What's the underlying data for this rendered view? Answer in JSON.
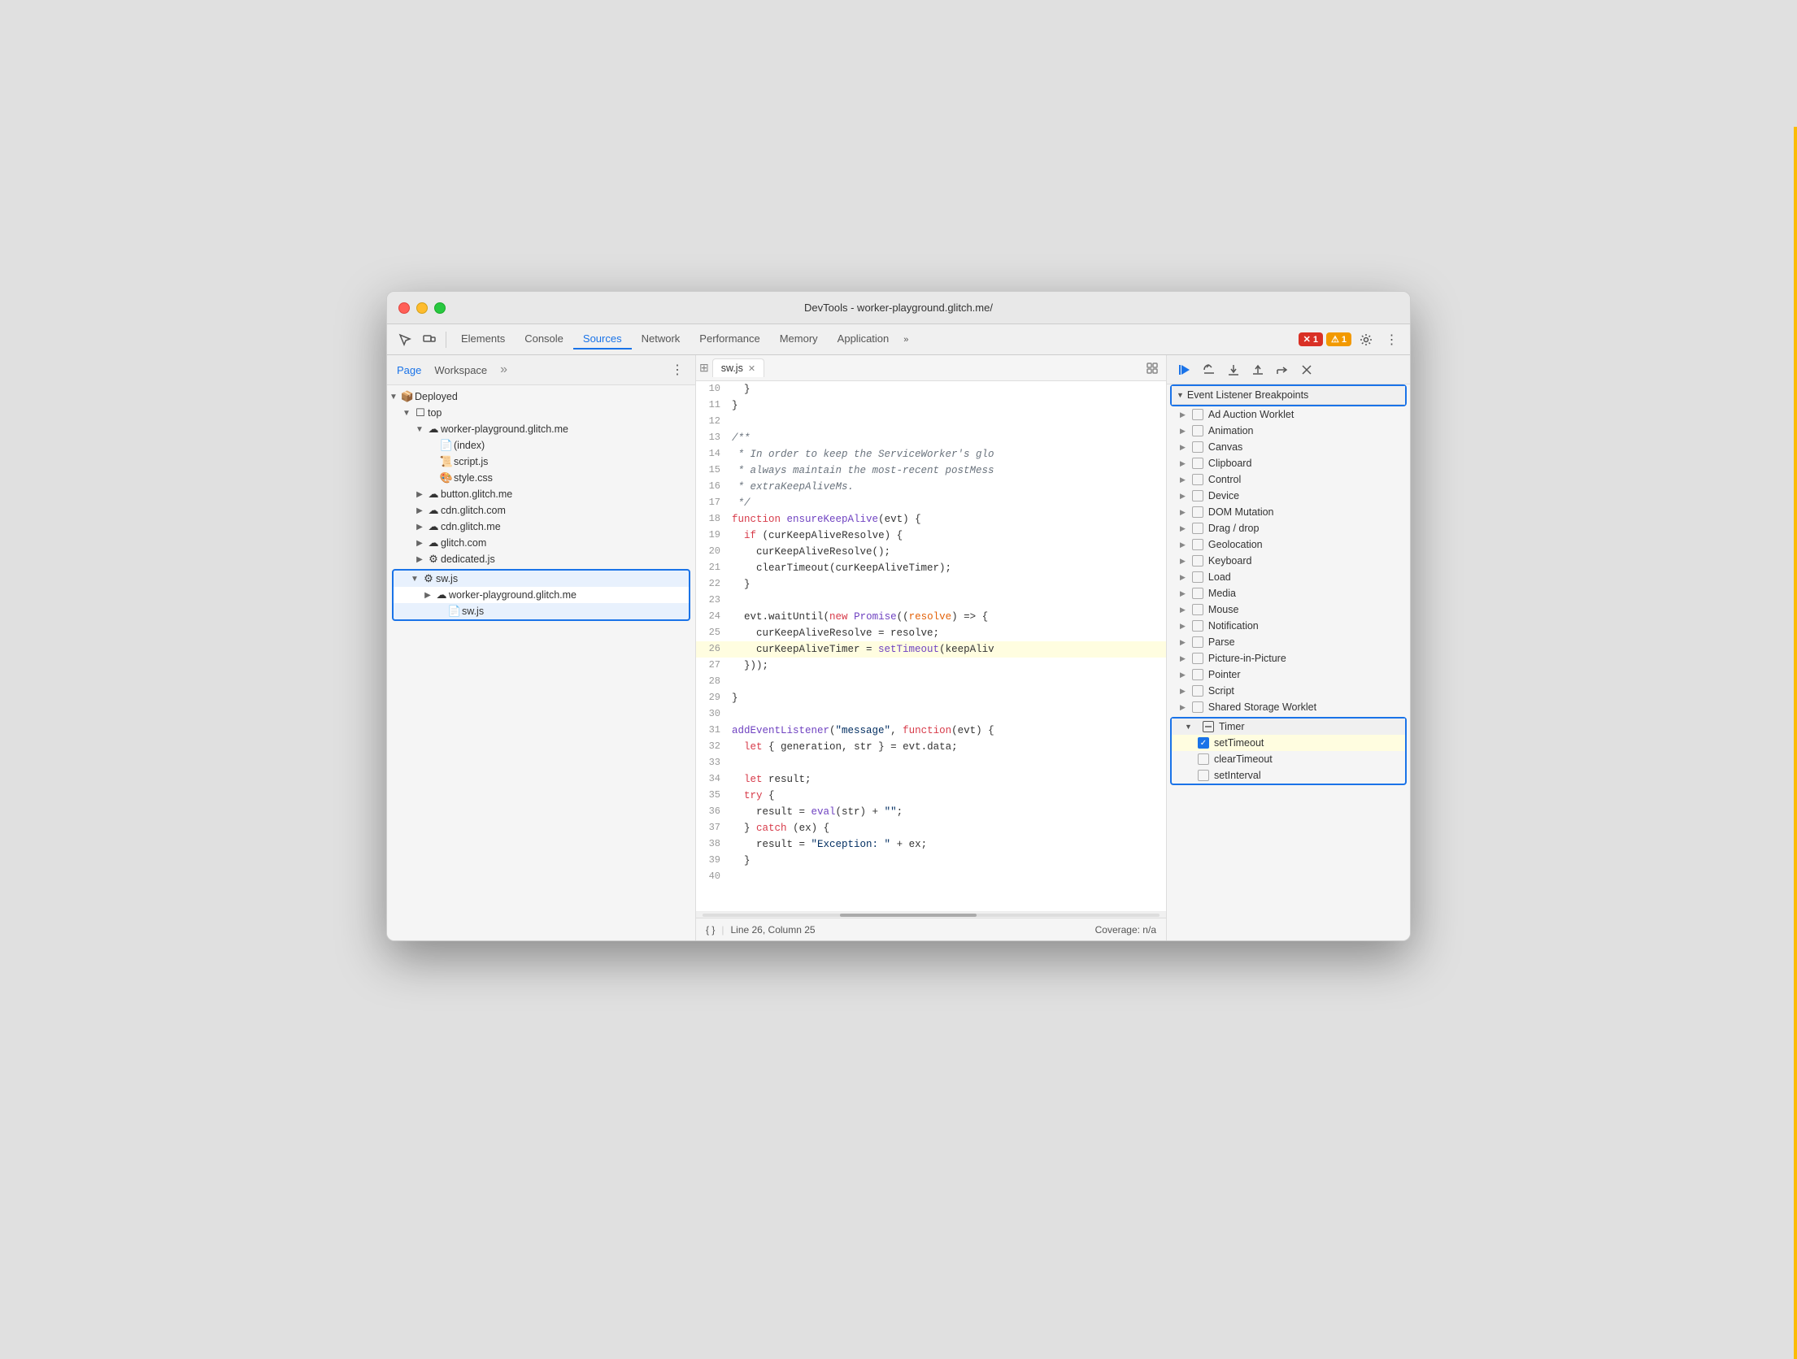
{
  "window": {
    "title": "DevTools - worker-playground.glitch.me/"
  },
  "toolbar": {
    "tabs": [
      {
        "id": "elements",
        "label": "Elements",
        "active": false
      },
      {
        "id": "console",
        "label": "Console",
        "active": false
      },
      {
        "id": "sources",
        "label": "Sources",
        "active": true
      },
      {
        "id": "network",
        "label": "Network",
        "active": false
      },
      {
        "id": "performance",
        "label": "Performance",
        "active": false
      },
      {
        "id": "memory",
        "label": "Memory",
        "active": false
      },
      {
        "id": "application",
        "label": "Application",
        "active": false
      }
    ],
    "more_tabs_label": "»",
    "error_count": "1",
    "warn_count": "1"
  },
  "file_panel": {
    "tabs": [
      {
        "id": "page",
        "label": "Page",
        "active": true
      },
      {
        "id": "workspace",
        "label": "Workspace",
        "active": false
      }
    ],
    "more": "»",
    "tree": [
      {
        "level": 0,
        "arrow": "▼",
        "icon": "📦",
        "label": "Deployed"
      },
      {
        "level": 1,
        "arrow": "▼",
        "icon": "☐",
        "label": "top"
      },
      {
        "level": 2,
        "arrow": "▼",
        "icon": "☁",
        "label": "worker-playground.glitch.me"
      },
      {
        "level": 3,
        "arrow": "",
        "icon": "📄",
        "label": "(index)"
      },
      {
        "level": 3,
        "arrow": "",
        "icon": "📜",
        "label": "script.js",
        "orange": true
      },
      {
        "level": 3,
        "arrow": "",
        "icon": "🎨",
        "label": "style.css",
        "purple": true
      },
      {
        "level": 2,
        "arrow": "▶",
        "icon": "☁",
        "label": "button.glitch.me"
      },
      {
        "level": 2,
        "arrow": "▶",
        "icon": "☁",
        "label": "cdn.glitch.com"
      },
      {
        "level": 2,
        "arrow": "▶",
        "icon": "☁",
        "label": "cdn.glitch.me"
      },
      {
        "level": 2,
        "arrow": "▶",
        "icon": "☁",
        "label": "glitch.com"
      },
      {
        "level": 2,
        "arrow": "▶",
        "icon": "⚙",
        "label": "dedicated.js"
      },
      {
        "level": 1,
        "arrow": "▼",
        "icon": "⚙",
        "label": "sw.js",
        "selected_group_start": true
      },
      {
        "level": 2,
        "arrow": "▶",
        "icon": "☁",
        "label": "worker-playground.glitch.me"
      },
      {
        "level": 3,
        "arrow": "",
        "icon": "📄",
        "label": "sw.js",
        "selected_group_end": true
      }
    ]
  },
  "code_panel": {
    "tab_label": "sw.js",
    "lines": [
      {
        "num": 10,
        "content": "  }"
      },
      {
        "num": 11,
        "content": "}"
      },
      {
        "num": 12,
        "content": ""
      },
      {
        "num": 13,
        "content": "/**",
        "type": "comment"
      },
      {
        "num": 14,
        "content": " * In order to keep the ServiceWorker's glo",
        "type": "comment"
      },
      {
        "num": 15,
        "content": " * always maintain the most-recent postMess",
        "type": "comment"
      },
      {
        "num": 16,
        "content": " * extraKeepAliveMs.",
        "type": "comment"
      },
      {
        "num": 17,
        "content": " */",
        "type": "comment"
      },
      {
        "num": 18,
        "content": "function ensureKeepAlive(evt) {",
        "type": "mixed"
      },
      {
        "num": 19,
        "content": "  if (curKeepAliveResolve) {",
        "type": "mixed"
      },
      {
        "num": 20,
        "content": "    curKeepAliveResolve();",
        "type": "plain"
      },
      {
        "num": 21,
        "content": "    clearTimeout(curKeepAliveTimer);",
        "type": "plain"
      },
      {
        "num": 22,
        "content": "  }",
        "type": "plain"
      },
      {
        "num": 23,
        "content": ""
      },
      {
        "num": 24,
        "content": "  evt.waitUntil(new Promise((resolve) => {",
        "type": "mixed"
      },
      {
        "num": 25,
        "content": "    curKeepAliveResolve = resolve;",
        "type": "plain"
      },
      {
        "num": 26,
        "content": "    curKeepAliveTimer = setTimeout(keepAliv",
        "type": "highlighted"
      },
      {
        "num": 27,
        "content": "  }));",
        "type": "plain"
      },
      {
        "num": 28,
        "content": ""
      },
      {
        "num": 29,
        "content": "}"
      },
      {
        "num": 30,
        "content": ""
      },
      {
        "num": 31,
        "content": "addEventListener(\"message\", function(evt) {",
        "type": "mixed"
      },
      {
        "num": 32,
        "content": "  let { generation, str } = evt.data;",
        "type": "plain"
      },
      {
        "num": 33,
        "content": ""
      },
      {
        "num": 34,
        "content": "  let result;",
        "type": "plain"
      },
      {
        "num": 35,
        "content": "  try {",
        "type": "plain"
      },
      {
        "num": 36,
        "content": "    result = eval(str) + \"\";",
        "type": "mixed"
      },
      {
        "num": 37,
        "content": "  } catch (ex) {",
        "type": "plain"
      },
      {
        "num": 38,
        "content": "    result = \"Exception: \" + ex;",
        "type": "mixed"
      },
      {
        "num": 39,
        "content": "  }",
        "type": "plain"
      },
      {
        "num": 40,
        "content": ""
      }
    ],
    "status_bar": {
      "format_label": "{ }",
      "position": "Line 26, Column 25",
      "coverage": "Coverage: n/a"
    }
  },
  "breakpoints_panel": {
    "section_title": "Event Listener Breakpoints",
    "items": [
      {
        "label": "Ad Auction Worklet",
        "checked": false,
        "expanded": false
      },
      {
        "label": "Animation",
        "checked": false,
        "expanded": false
      },
      {
        "label": "Canvas",
        "checked": false,
        "expanded": false
      },
      {
        "label": "Clipboard",
        "checked": false,
        "expanded": false
      },
      {
        "label": "Control",
        "checked": false,
        "expanded": false
      },
      {
        "label": "Device",
        "checked": false,
        "expanded": false
      },
      {
        "label": "DOM Mutation",
        "checked": false,
        "expanded": false
      },
      {
        "label": "Drag / drop",
        "checked": false,
        "expanded": false
      },
      {
        "label": "Geolocation",
        "checked": false,
        "expanded": false
      },
      {
        "label": "Keyboard",
        "checked": false,
        "expanded": false
      },
      {
        "label": "Load",
        "checked": false,
        "expanded": false
      },
      {
        "label": "Media",
        "checked": false,
        "expanded": false
      },
      {
        "label": "Mouse",
        "checked": false,
        "expanded": false
      },
      {
        "label": "Notification",
        "checked": false,
        "expanded": false
      },
      {
        "label": "Parse",
        "checked": false,
        "expanded": false
      },
      {
        "label": "Picture-in-Picture",
        "checked": false,
        "expanded": false
      },
      {
        "label": "Pointer",
        "checked": false,
        "expanded": false
      },
      {
        "label": "Script",
        "checked": false,
        "expanded": false
      },
      {
        "label": "Shared Storage Worklet",
        "checked": false,
        "expanded": false
      },
      {
        "label": "Timer",
        "checked": false,
        "expanded": true,
        "highlighted": true
      },
      {
        "label": "setTimeout",
        "checked": true,
        "sub": true,
        "highlighted_item": true
      },
      {
        "label": "clearTimeout",
        "checked": false,
        "sub": true
      },
      {
        "label": "setInterval",
        "checked": false,
        "sub": true
      }
    ]
  }
}
